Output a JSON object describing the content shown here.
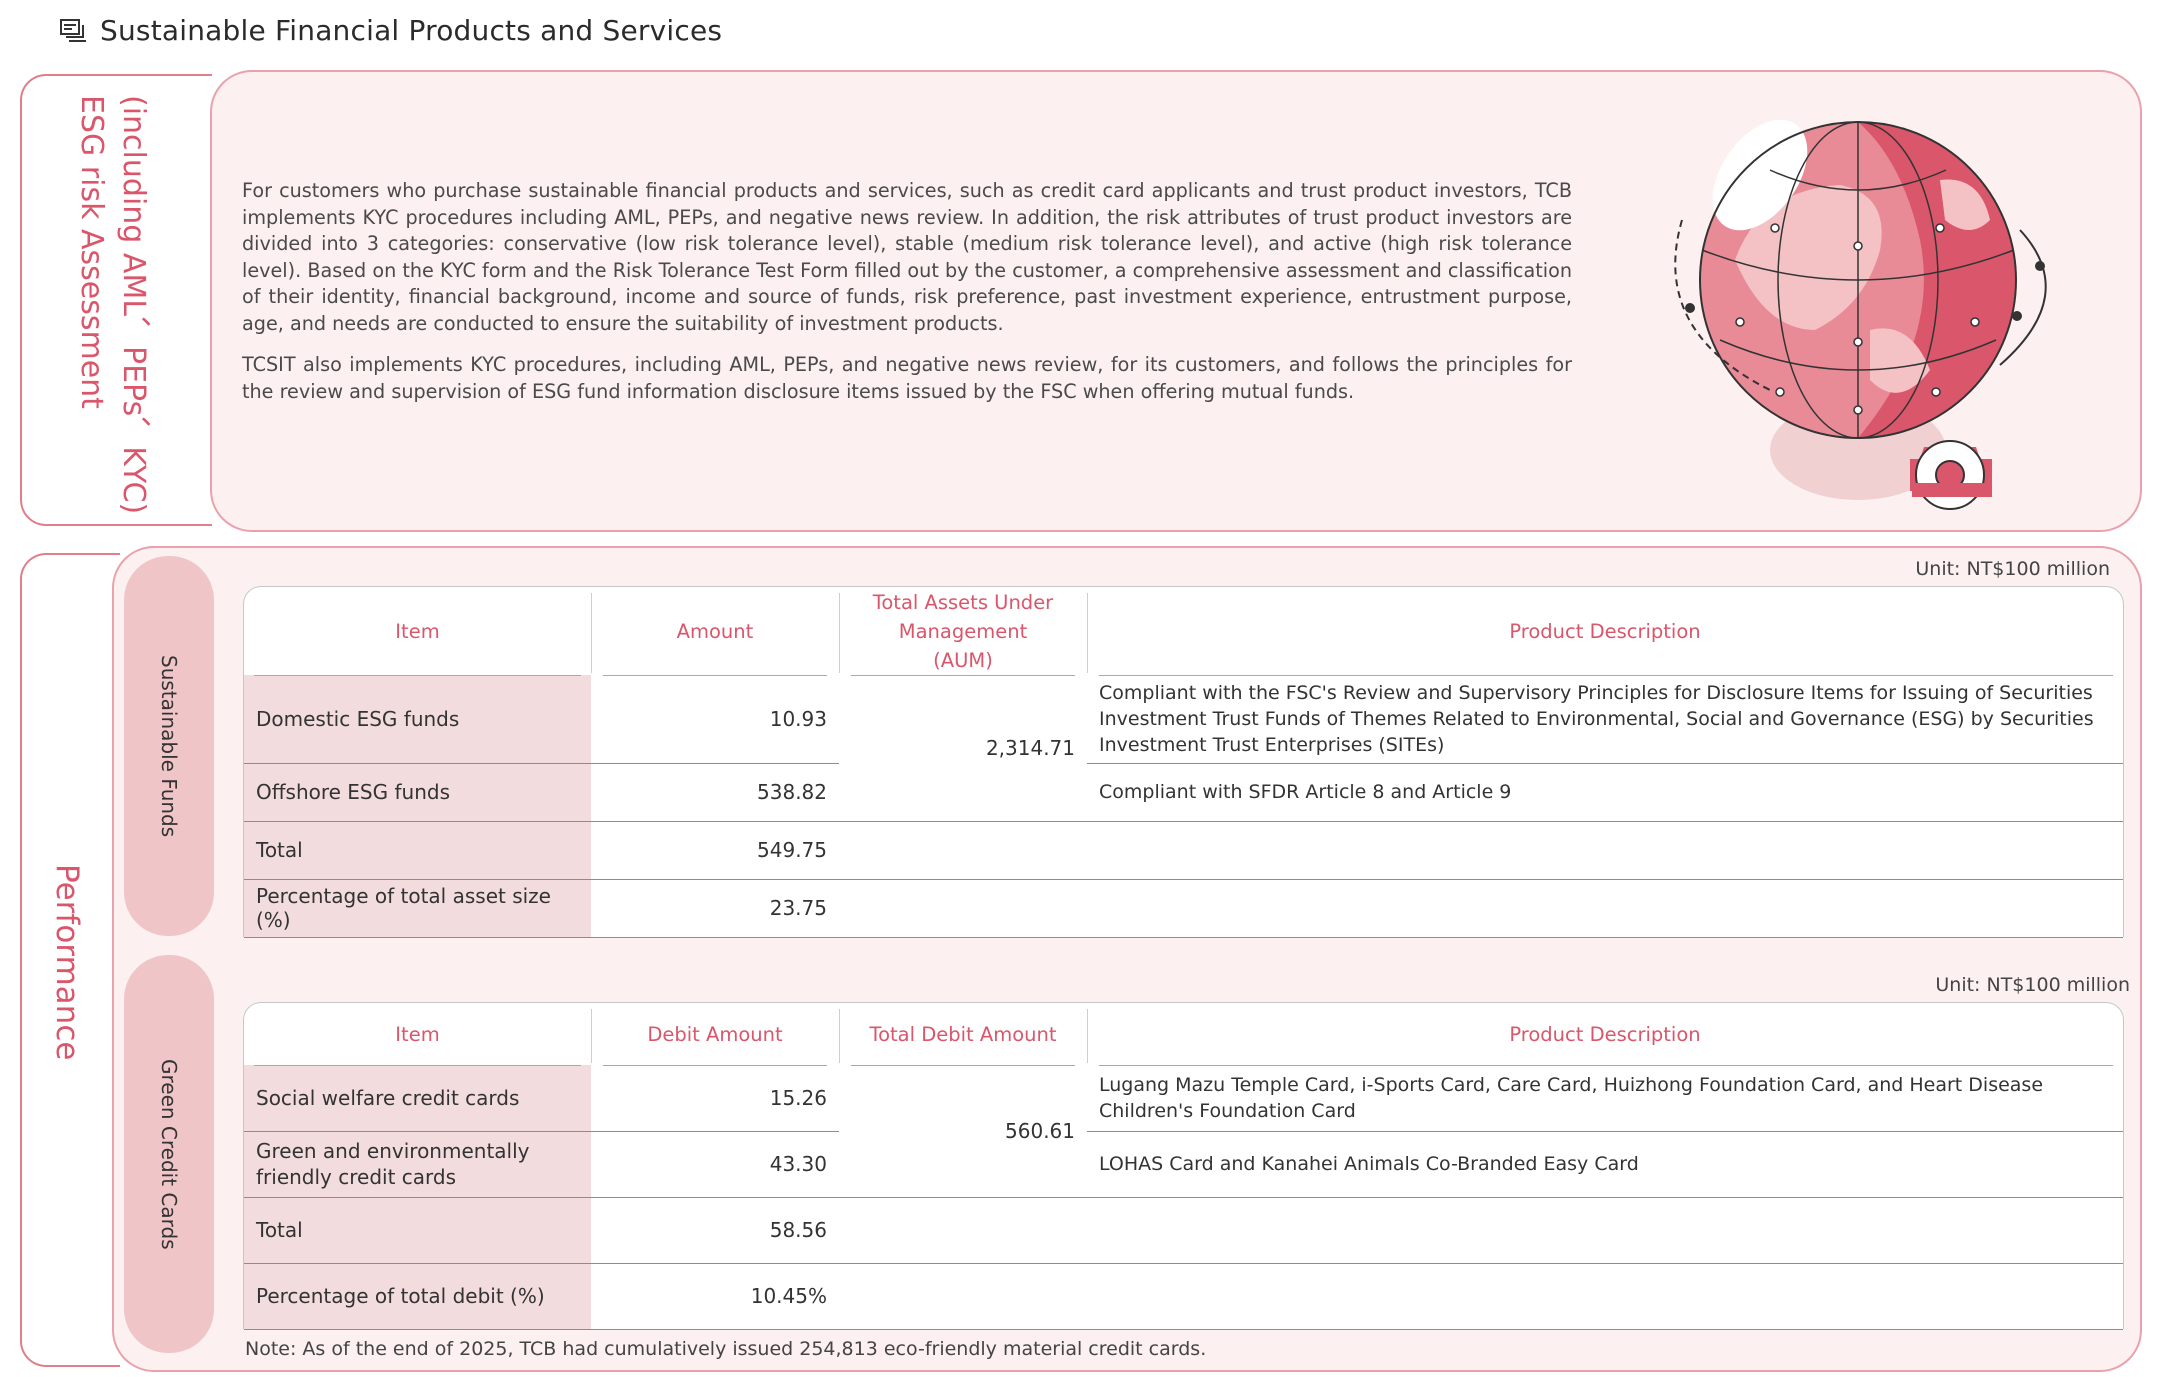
{
  "page_title": "Sustainable Financial Products and Services",
  "risk_section": {
    "title_line1": "(including AML、PEPs、KYC)",
    "title_line2": "ESG risk Assessment",
    "paragraph1": "For customers who purchase sustainable financial products and services, such as credit card applicants and trust product investors, TCB implements KYC procedures including AML, PEPs, and negative news review. In addition, the risk attributes of trust product investors are divided into 3 categories: conservative (low risk tolerance level), stable (medium risk tolerance level), and active (high risk tolerance level). Based on the KYC form and the Risk Tolerance Test Form filled out by the customer, a comprehensive assessment and classification of their identity, financial background, income and source of funds, risk preference, past investment experience, entrustment purpose, age, and needs are conducted to ensure the suitability of investment products.",
    "paragraph2": "TCSIT also implements KYC procedures, including AML, PEPs, and negative news review, for its customers, and follows the principles for the review and supervision of ESG fund information disclosure items issued by the FSC when offering mutual funds."
  },
  "performance": {
    "title": "Performance",
    "sustainable_funds": {
      "label": "Sustainable Funds",
      "unit": "Unit: NT$100 million",
      "headers": [
        "Item",
        "Amount",
        "Total Assets Under Management (AUM)",
        "Product Description"
      ],
      "rows": [
        {
          "item": "Domestic ESG funds",
          "amount": "10.93",
          "description": "Compliant with the FSC's Review and Supervisory Principles for Disclosure Items for Issuing of Securities Investment Trust Funds of Themes Related to Environmental, Social and Governance (ESG) by Securities Investment Trust Enterprises (SITEs)"
        },
        {
          "item": "Offshore ESG funds",
          "amount": "538.82",
          "description": "Compliant with SFDR Article 8 and Article 9"
        },
        {
          "item": "Total",
          "amount": "549.75",
          "description": ""
        },
        {
          "item": "Percentage of total asset size (%)",
          "amount": "23.75",
          "description": ""
        }
      ],
      "aum_total": "2,314.71"
    },
    "green_cards": {
      "label": "Green Credit Cards",
      "unit": "Unit: NT$100 million",
      "headers": [
        "Item",
        "Debit Amount",
        "Total Debit Amount",
        "Product Description"
      ],
      "rows": [
        {
          "item": "Social welfare credit cards",
          "amount": "15.26",
          "description": "Lugang Mazu Temple Card, i-Sports Card, Care Card, Huizhong Foundation Card, and Heart Disease Children's Foundation Card"
        },
        {
          "item": "Green and environmentally friendly credit cards",
          "amount": "43.30",
          "description": "LOHAS Card and Kanahei Animals Co-Branded Easy Card"
        },
        {
          "item": "Total",
          "amount": "58.56",
          "description": ""
        },
        {
          "item": "Percentage of total debit (%)",
          "amount": "10.45%",
          "description": ""
        }
      ],
      "total_debit": "560.61"
    },
    "note": "Note: As of the end of 2025, TCB had cumulatively issued 254,813 eco-friendly material credit cards."
  },
  "colors": {
    "accent": "#d9566b",
    "panel_bg": "#fcf0f0",
    "pill": "#f0c5c8",
    "item_bg": "#f3dcdd"
  }
}
